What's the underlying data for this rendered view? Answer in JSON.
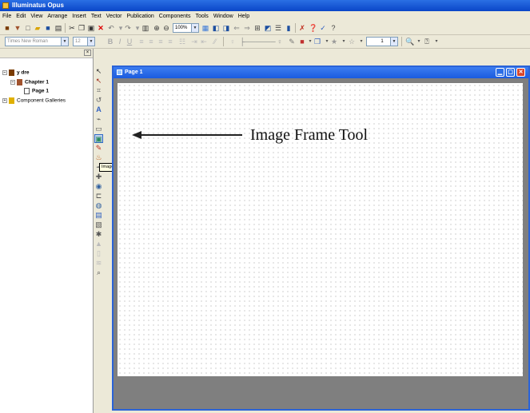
{
  "app": {
    "title": "Illuminatus Opus"
  },
  "menu": [
    "File",
    "Edit",
    "View",
    "Arrange",
    "Insert",
    "Text",
    "Vector",
    "Publication",
    "Components",
    "Tools",
    "Window",
    "Help"
  ],
  "toolbar": {
    "zoom_value": "100%",
    "font_value": "Times New Roman",
    "size_value": "12",
    "line_value": "1"
  },
  "tree": {
    "root": "y dre",
    "chapter": "Chapter 1",
    "page": "Page 1",
    "galleries": "Component Galleries"
  },
  "tooltip": "Image",
  "document": {
    "title": "Page 1"
  },
  "annotation": {
    "label": "Image Frame Tool"
  },
  "colors": {
    "title_blue": "#0a46c8",
    "window_border": "#2a63d8",
    "close_red": "#d8452b"
  }
}
